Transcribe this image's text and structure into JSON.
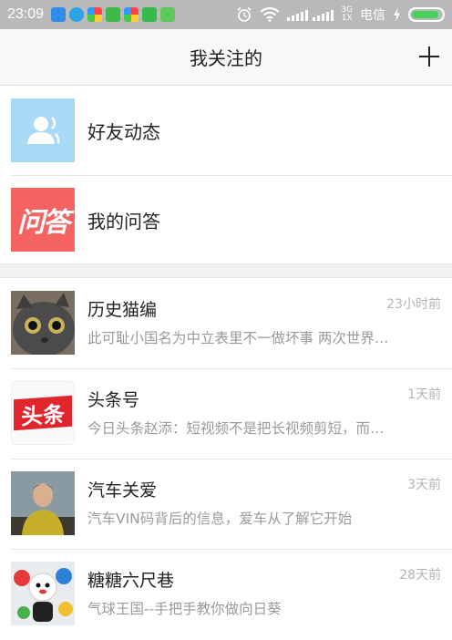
{
  "status_bar": {
    "time": "23:09",
    "net_type_top": "3G",
    "net_type_bottom": "1X",
    "carrier": "电信",
    "battery_level": 0.9,
    "notification_icons": [
      "app-blue-icon",
      "cloud-icon",
      "app-rainbow-icon",
      "app-green-icon",
      "app-rainbow-icon",
      "app-green-y-icon",
      "app-green-face-icon"
    ]
  },
  "header": {
    "title": "我关注的",
    "add_icon": "plus-icon"
  },
  "menu": [
    {
      "label": "好友动态",
      "icon": "user-icon"
    },
    {
      "label": "我的问答",
      "icon_text": "问答"
    }
  ],
  "feed": [
    {
      "name": "历史猫编",
      "time": "23小时前",
      "snippet": "此可耻小国名为中立表里不一做坏事 两次世界…"
    },
    {
      "name": "头条号",
      "time": "1天前",
      "snippet": "今日头条赵添：短视频不是把长视频剪短，而…",
      "avatar_text": "头条"
    },
    {
      "name": "汽车关爱",
      "time": "3天前",
      "snippet": "汽车VIN码背后的信息，爱车从了解它开始"
    },
    {
      "name": "糖糖六尺巷",
      "time": "28天前",
      "snippet": "气球王国--手把手教你做向日葵"
    }
  ],
  "colors": {
    "status_bar": "#b9b9b9",
    "friends_icon_bg": "#a8daf6",
    "qa_icon_bg": "#f56262",
    "toutiao_red": "#e0262c",
    "battery_green": "#49d05a"
  }
}
